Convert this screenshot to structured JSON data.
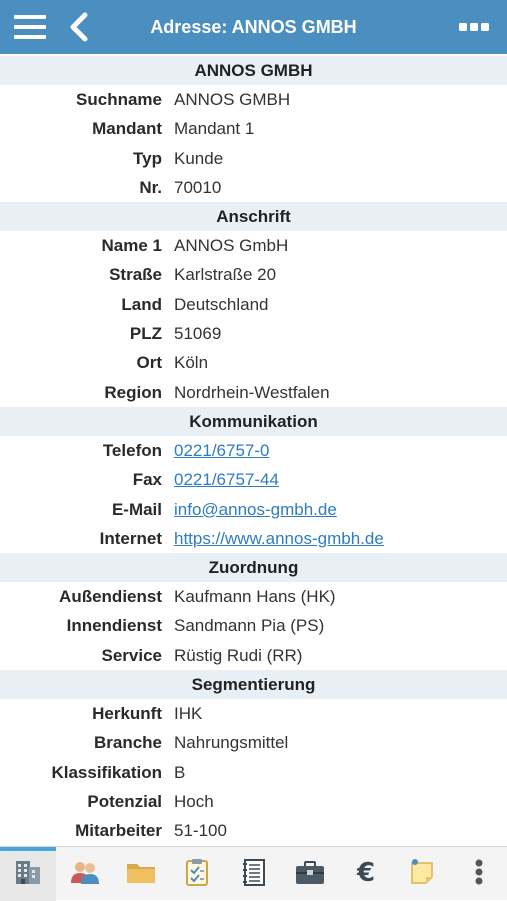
{
  "header": {
    "title": "Adresse: ANNOS GMBH"
  },
  "sections": [
    {
      "title": "ANNOS GMBH",
      "rows": [
        {
          "label": "Suchname",
          "value": "ANNOS GMBH"
        },
        {
          "label": "Mandant",
          "value": "Mandant 1"
        },
        {
          "label": "Typ",
          "value": "Kunde"
        },
        {
          "label": "Nr.",
          "value": "70010"
        }
      ]
    },
    {
      "title": "Anschrift",
      "rows": [
        {
          "label": "Name 1",
          "value": "ANNOS GmbH"
        },
        {
          "label": "Straße",
          "value": "Karlstraße 20"
        },
        {
          "label": "Land",
          "value": "Deutschland"
        },
        {
          "label": "PLZ",
          "value": "51069"
        },
        {
          "label": "Ort",
          "value": "Köln"
        },
        {
          "label": "Region",
          "value": "Nordrhein-Westfalen"
        }
      ]
    },
    {
      "title": "Kommunikation",
      "rows": [
        {
          "label": "Telefon",
          "value": "0221/6757-0"
        },
        {
          "label": "Fax",
          "value": "0221/6757-44"
        },
        {
          "label": "E-Mail",
          "value": "info@annos-gmbh.de"
        },
        {
          "label": "Internet",
          "value": "https://www.annos-gmbh.de"
        }
      ]
    },
    {
      "title": "Zuordnung",
      "rows": [
        {
          "label": "Außendienst",
          "value": "Kaufmann Hans (HK)"
        },
        {
          "label": "Innendienst",
          "value": "Sandmann Pia (PS)"
        },
        {
          "label": "Service",
          "value": "Rüstig Rudi (RR)"
        }
      ]
    },
    {
      "title": "Segmentierung",
      "rows": [
        {
          "label": "Herkunft",
          "value": "IHK"
        },
        {
          "label": "Branche",
          "value": "Nahrungsmittel"
        },
        {
          "label": "Klassifikation",
          "value": "B"
        },
        {
          "label": "Potenzial",
          "value": "Hoch"
        },
        {
          "label": "Mitarbeiter",
          "value": "51-100"
        }
      ]
    }
  ],
  "tabbar": {
    "tabs": [
      {
        "icon": "building-icon",
        "active": true
      },
      {
        "icon": "contacts-icon",
        "active": false
      },
      {
        "icon": "folder-icon",
        "active": false
      },
      {
        "icon": "clipboard-check-icon",
        "active": false
      },
      {
        "icon": "notebook-icon",
        "active": false
      },
      {
        "icon": "briefcase-icon",
        "active": false
      },
      {
        "icon": "euro-icon",
        "active": false
      },
      {
        "icon": "note-pin-icon",
        "active": false
      },
      {
        "icon": "more-vertical-icon",
        "active": false
      }
    ]
  },
  "colors": {
    "header": "#4a8fc0",
    "section_bg": "#e8eff5",
    "link": "#2f7cc0",
    "active_tab_indicator": "#4aa5dd"
  }
}
